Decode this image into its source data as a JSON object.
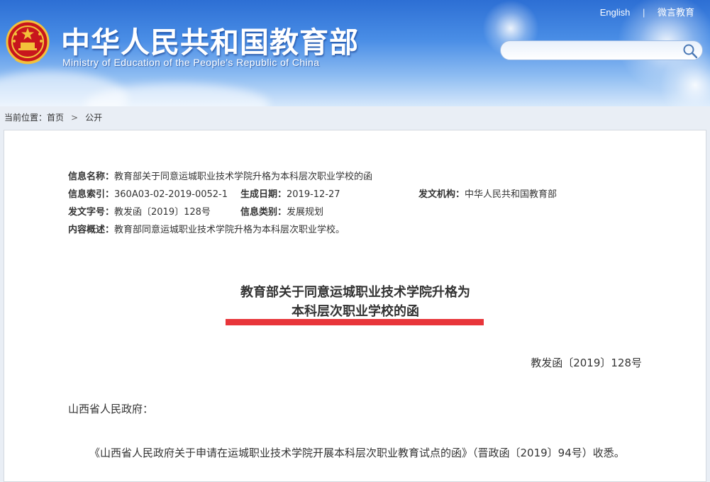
{
  "header": {
    "site_title": "中华人民共和国教育部",
    "site_subtitle": "Ministry of Education of the People's Republic of China",
    "links": [
      "English",
      "微言教育"
    ],
    "search": {
      "placeholder": "",
      "icon": "search-icon"
    },
    "emblem_icon": "national-emblem-icon"
  },
  "breadcrumb": {
    "prefix": "当前位置：",
    "items": [
      "首页",
      "公开"
    ],
    "separator": ">"
  },
  "meta": {
    "name_label": "信息名称：",
    "name_value": "教育部关于同意运城职业技术学院升格为本科层次职业学校的函",
    "index_label": "信息索引：",
    "index_value": "360A03-02-2019-0052-1",
    "date_label": "生成日期：",
    "date_value": "2019-12-27",
    "org_label": "发文机构：",
    "org_value": "中华人民共和国教育部",
    "docno_label": "发文字号：",
    "docno_value": "教发函〔2019〕128号",
    "category_label": "信息类别：",
    "category_value": "发展规划",
    "summary_label": "内容概述：",
    "summary_value": "教育部同意运城职业技术学院升格为本科层次职业学校。"
  },
  "document": {
    "title_line1": "教育部关于同意运城职业技术学院升格为",
    "title_line2": "本科层次职业学校的函",
    "number": "教发函〔2019〕128号",
    "addressee": "山西省人民政府：",
    "body": "《山西省人民政府关于申请在运城职业技术学院开展本科层次职业教育试点的函》（晋政函〔2019〕94号）收悉。"
  },
  "colors": {
    "header_blue": "#2d6fd4",
    "title_underline": "#e8353a",
    "text": "#333333"
  }
}
